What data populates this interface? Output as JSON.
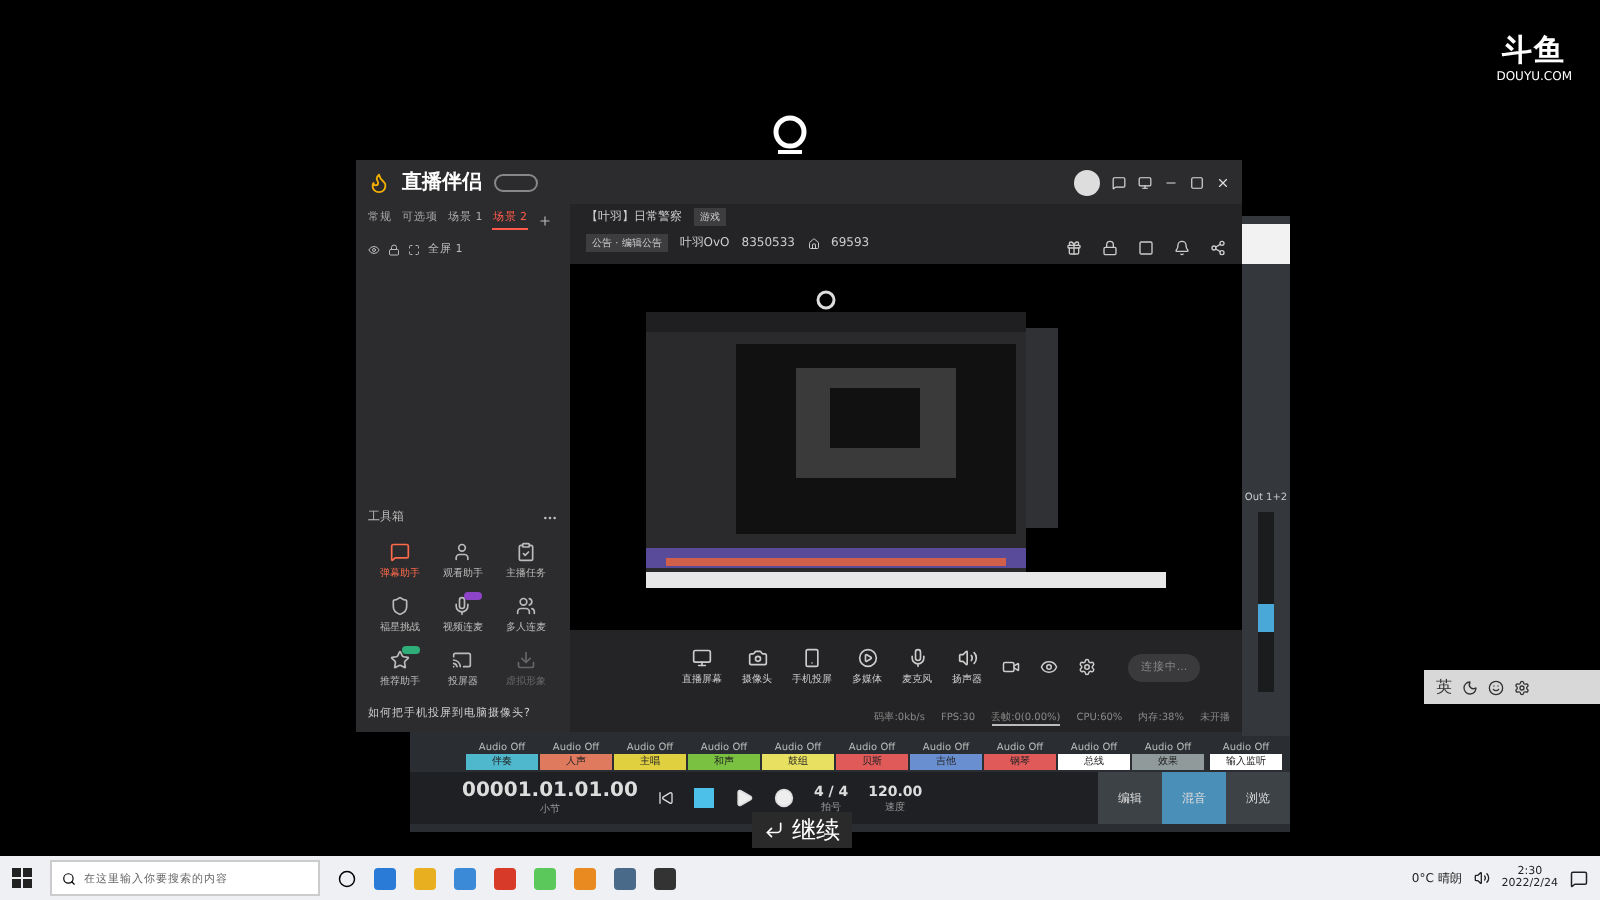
{
  "overlay_logo": {
    "name": "斗鱼",
    "site": "DOUYU.COM"
  },
  "app": {
    "title": "直播伴侣",
    "scene_tabs": [
      {
        "label": "常规",
        "selected": false
      },
      {
        "label": "可选项",
        "selected": false
      },
      {
        "label": "场景 1",
        "selected": false
      },
      {
        "label": "场景 2",
        "selected": true
      }
    ],
    "sources": [
      {
        "label": "全屏 1"
      }
    ],
    "toolbox": {
      "title": "工具箱",
      "tools": [
        {
          "label": "弹幕助手",
          "selected": true,
          "disabled": false
        },
        {
          "label": "观看助手",
          "selected": false,
          "disabled": false
        },
        {
          "label": "主播任务",
          "selected": false,
          "disabled": false
        },
        {
          "label": "福星挑战",
          "selected": false,
          "disabled": false
        },
        {
          "label": "视频连麦",
          "selected": false,
          "disabled": false,
          "color": "#8e44c8"
        },
        {
          "label": "多人连麦",
          "selected": false,
          "disabled": false
        },
        {
          "label": "推荐助手",
          "selected": false,
          "disabled": false,
          "color": "#2fae7a"
        },
        {
          "label": "投屏器",
          "selected": false,
          "disabled": false
        },
        {
          "label": "虚拟形象",
          "selected": false,
          "disabled": true
        }
      ]
    },
    "hint": "如何把手机投屏到电脑摄像头?",
    "stream": {
      "title": "【叶羽】日常警察",
      "category": "游戏",
      "notice": "公告 · 编辑公告",
      "streamer": "叶羽OvO",
      "room": "8350533",
      "heat": "69593"
    },
    "sources_bar": [
      {
        "label": "直播屏幕"
      },
      {
        "label": "摄像头"
      },
      {
        "label": "手机投屏"
      },
      {
        "label": "多媒体"
      },
      {
        "label": "麦克风"
      },
      {
        "label": "扬声器"
      }
    ],
    "start_button": "连接中...",
    "status": [
      {
        "label": "码率:0kb/s",
        "selected": false
      },
      {
        "label": "FPS:30",
        "selected": false
      },
      {
        "label": "丢帧:0(0.00%)",
        "selected": true
      },
      {
        "label": "CPU:60%",
        "selected": false
      },
      {
        "label": "内存:38%",
        "selected": false
      },
      {
        "label": "未开播",
        "selected": false
      }
    ]
  },
  "daw": {
    "channels": [
      {
        "auto": "Audio Off",
        "name": "伴奏",
        "color": "#4fb8cc"
      },
      {
        "auto": "Audio Off",
        "name": "人声",
        "color": "#e07a5f"
      },
      {
        "auto": "Audio Off",
        "name": "主唱",
        "color": "#e0d040"
      },
      {
        "auto": "Audio Off",
        "name": "和声",
        "color": "#7ac142"
      },
      {
        "auto": "Audio Off",
        "name": "鼓组",
        "color": "#e8e060"
      },
      {
        "auto": "Audio Off",
        "name": "贝斯",
        "color": "#e05a5a"
      },
      {
        "auto": "Audio Off",
        "name": "吉他",
        "color": "#6a8fd0"
      },
      {
        "auto": "Audio Off",
        "name": "钢琴",
        "color": "#e05a5a"
      },
      {
        "auto": "Audio Off",
        "name": "总线",
        "color": "#ffffff"
      },
      {
        "auto": "Audio Off",
        "name": "效果",
        "color": "#909a9a"
      }
    ],
    "monitor": {
      "auto": "Audio Off",
      "name": "输入监听"
    },
    "output": "Out 1+2",
    "time": "00001.01.01.00",
    "time_label": "小节",
    "signature": "4 / 4",
    "signature_label": "拍号",
    "tempo": "120.00",
    "tempo_label": "速度",
    "views": [
      {
        "label": "编辑",
        "selected": false
      },
      {
        "label": "混音",
        "selected": true
      },
      {
        "label": "浏览",
        "selected": false
      }
    ]
  },
  "subtitle": "继续",
  "ime": "英",
  "taskbar": {
    "search_placeholder": "在这里输入你要搜索的内容",
    "weather": "0°C 晴朗",
    "time": "2:30",
    "date": "2022/2/24"
  }
}
